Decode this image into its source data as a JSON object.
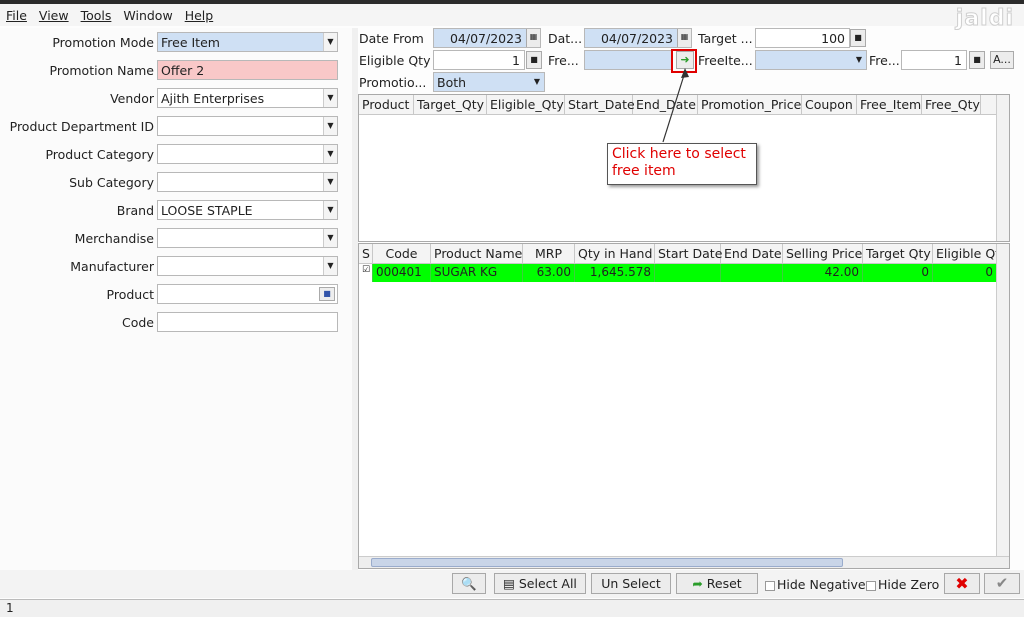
{
  "menu": [
    "File",
    "View",
    "Tools",
    "Window",
    "Help"
  ],
  "logo": "jaldi",
  "left_form": [
    {
      "label": "Promotion Mode",
      "value": "Free Item"
    },
    {
      "label": "Promotion Name",
      "value": "Offer 2"
    },
    {
      "label": "Vendor",
      "value": "Ajith Enterprises"
    },
    {
      "label": "Product Department ID",
      "value": ""
    },
    {
      "label": "Product Category",
      "value": ""
    },
    {
      "label": "Sub Category",
      "value": ""
    },
    {
      "label": "Brand",
      "value": "LOOSE STAPLE"
    },
    {
      "label": "Merchandise",
      "value": ""
    },
    {
      "label": "Manufacturer",
      "value": ""
    },
    {
      "label": "Product",
      "value": ""
    },
    {
      "label": "Code",
      "value": ""
    }
  ],
  "top_form": {
    "date_from_label": "Date From",
    "date_from": "04/07/2023",
    "date_to_label": "Dat...",
    "date_to": "04/07/2023",
    "target_label": "Target ...",
    "target_value": "100",
    "eligible_qty_label": "Eligible Qty",
    "eligible_qty": "1",
    "free_label": "Fre...",
    "free_value": "",
    "free_item_label": "FreeIte...",
    "free_item_value": "",
    "free_qty_label": "Fre...",
    "free_qty": "1",
    "a_button": "A...",
    "promotion_label": "Promotio...",
    "promotion_value": "Both"
  },
  "grid1": {
    "columns": [
      "Product",
      "Target_Qty",
      "Eligible_Qty",
      "Start_Date",
      "End_Date",
      "Promotion_Price",
      "Coupon",
      "Free_Item",
      "Free_Qty"
    ]
  },
  "grid2": {
    "columns": [
      "S",
      "Code",
      "Product Name",
      "MRP",
      "Qty in Hand",
      "Start Date",
      "End Date",
      "Selling Price",
      "Target Qty",
      "Eligible Qty"
    ],
    "rows": [
      {
        "code": "000401",
        "product_name": "SUGAR KG",
        "mrp": "63.00",
        "qty_in_hand": "1,645.578",
        "start_date": "",
        "end_date": "",
        "selling_price": "42.00",
        "target_qty": "0",
        "eligible_qty": "0"
      }
    ]
  },
  "callout": "Click here to select free item",
  "bottom": {
    "select_all": "Select All",
    "un_select": "Un Select",
    "reset": "Reset",
    "hide_negative": "Hide Negative",
    "hide_zero": "Hide Zero"
  },
  "status": "1",
  "colors": {
    "selected_row": "#00ff00",
    "callout_text": "#e00000",
    "highlight_field": "#f9c8c8"
  }
}
